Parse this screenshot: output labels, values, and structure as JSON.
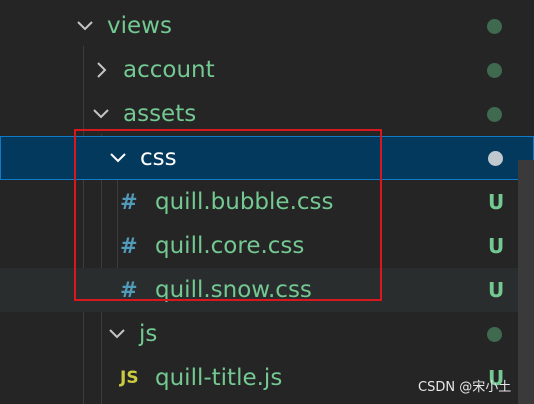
{
  "explorer": {
    "rows": [
      {
        "label": "views",
        "kind": "folder-open"
      },
      {
        "label": "account",
        "kind": "folder-closed"
      },
      {
        "label": "assets",
        "kind": "folder-open"
      },
      {
        "label": "css",
        "kind": "folder-open",
        "selected": true
      },
      {
        "label": "quill.bubble.css",
        "kind": "css-file",
        "status": "U",
        "icon": "#"
      },
      {
        "label": "quill.core.css",
        "kind": "css-file",
        "status": "U",
        "icon": "#"
      },
      {
        "label": "quill.snow.css",
        "kind": "css-file",
        "status": "U",
        "icon": "#"
      },
      {
        "label": "js",
        "kind": "folder-open"
      },
      {
        "label": "quill-title.js",
        "kind": "js-file",
        "status": "U",
        "icon": "JS"
      }
    ]
  },
  "watermark": "CSDN @宋小土",
  "colors": {
    "background": "#252526",
    "untracked_text": "#73c991",
    "selection_bg": "#04395e",
    "selection_border": "#0e7ac8",
    "annotation_box": "#d8181e",
    "css_icon": "#519aba",
    "js_icon": "#cbcb41"
  }
}
